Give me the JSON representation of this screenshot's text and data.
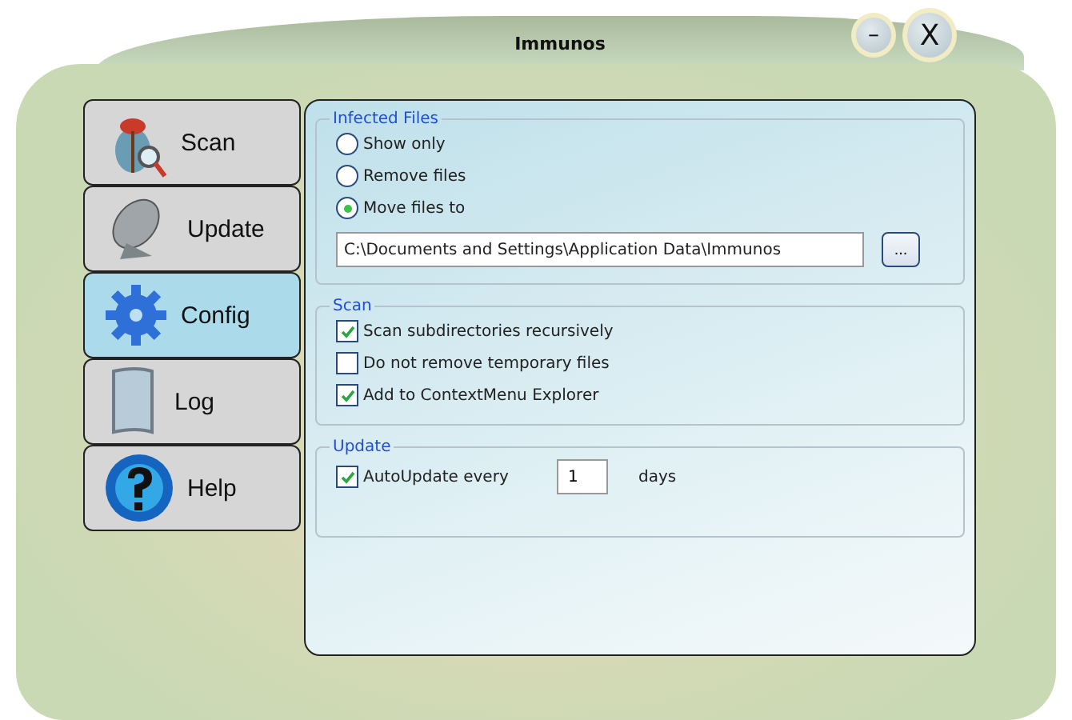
{
  "window": {
    "title": "Immunos",
    "controls": [
      {
        "kind": "minimize",
        "label": "–"
      },
      {
        "kind": "close",
        "label": "X"
      }
    ]
  },
  "nav": [
    {
      "kind": "scan",
      "label": "Scan",
      "selected": false
    },
    {
      "kind": "update",
      "label": "Update",
      "selected": false
    },
    {
      "kind": "config",
      "label": "Config",
      "selected": true
    },
    {
      "kind": "log",
      "label": "Log",
      "selected": false
    },
    {
      "kind": "help",
      "label": "Help",
      "selected": false
    }
  ],
  "infected_files": {
    "title": "Infected Files",
    "options": [
      {
        "label": "Show only",
        "selected": false
      },
      {
        "label": "Remove files",
        "selected": false
      },
      {
        "label": "Move files to",
        "selected": true
      }
    ],
    "path": "C:\\Documents and Settings\\Application Data\\Immunos",
    "browse": "..."
  },
  "scan": {
    "title": "Scan",
    "options": [
      {
        "label": "Scan subdirectories recursively",
        "checked": true
      },
      {
        "label": "Do not remove temporary files",
        "checked": false
      },
      {
        "label": "Add to ContextMenu Explorer",
        "checked": true
      }
    ]
  },
  "update": {
    "title": "Update",
    "label": "AutoUpdate every",
    "checked": true,
    "value": "1",
    "unit": "days"
  }
}
